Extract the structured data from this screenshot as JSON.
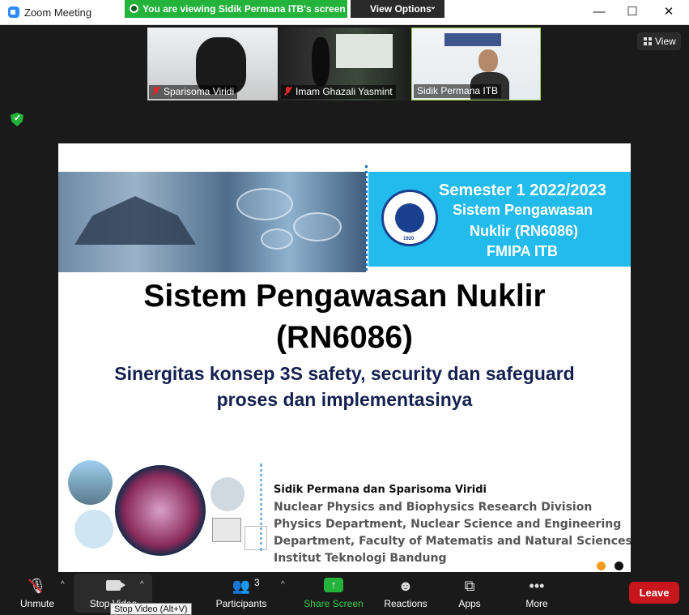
{
  "window": {
    "title": "Zoom Meeting",
    "share_banner": "You are viewing Sidik Permana ITB's screen",
    "view_options": "View Options"
  },
  "participants_strip": [
    {
      "name": "Sparisoma Viridi",
      "muted": true
    },
    {
      "name": "Imam Ghazali Yasmint",
      "muted": true
    },
    {
      "name": "Sidik Permana ITB",
      "muted": false
    }
  ],
  "view_button": "View",
  "slide": {
    "header_lines": [
      "Semester 1 2022/2023",
      "Sistem Pengawasan",
      "Nuklir (RN6086)",
      "FMIPA ITB"
    ],
    "logo_text": "INSTITUT TEKNOLOGI BANDUNG",
    "logo_year": "1920",
    "title_line1": "Sistem Pengawasan Nuklir",
    "title_line2": "(RN6086)",
    "subtitle_line1": "Sinergitas konsep 3S safety, security dan safeguard",
    "subtitle_line2": "proses dan implementasinya",
    "authors": "Sidik Permana dan Sparisoma Viridi",
    "affiliation_lines": [
      "Nuclear Physics and Biophysics Research Division",
      "Physics Department, Nuclear Science and Engineering",
      "Department, Faculty of Matematis and Natural Sciences,",
      "Institut Teknologi Bandung"
    ]
  },
  "toolbar": {
    "unmute": "Unmute",
    "stop_video": "Stop Video",
    "participants": "Participants",
    "participants_count": "3",
    "share_screen": "Share Screen",
    "reactions": "Reactions",
    "apps": "Apps",
    "more": "More",
    "leave": "Leave",
    "tooltip": "Stop Video (Alt+V)"
  },
  "colors": {
    "banner_green": "#23b33b",
    "slide_cyan": "#23bbeb",
    "subtitle_navy": "#14204f",
    "leave_red": "#c8161d"
  }
}
